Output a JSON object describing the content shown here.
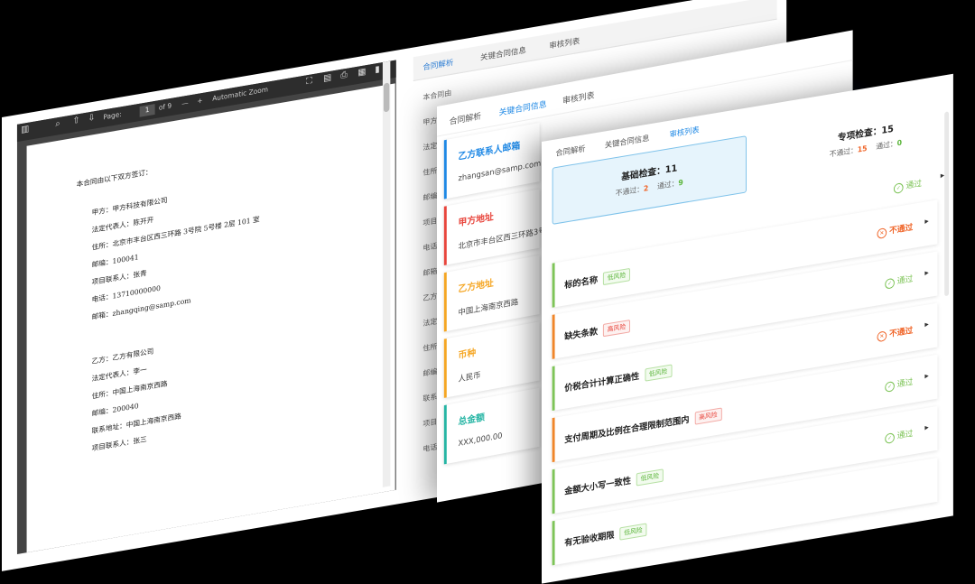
{
  "pdf_viewer": {
    "toolbar": {
      "page_label": "Page:",
      "page_number": "1",
      "page_total": "of 9",
      "zoom_minus": "—",
      "zoom_plus": "+",
      "zoom_select": "Automatic Zoom"
    },
    "doc_lines": [
      "本合同由以下双方签订：",
      "甲方：甲方科技有限公司",
      "法定代表人：陈开开",
      "住所：北京市丰台区西三环路 3号院 5号楼 2层 101 室",
      "邮编：100041",
      "项目联系人：张青",
      "电话：13710000000",
      "邮箱：zhangqing@samp.com",
      "乙方：乙方有限公司",
      "法定代表人：李一",
      "住所：中国上海南京西路",
      "邮编：200040",
      "联系地址：中国上海南京西路",
      "项目联系人：张三"
    ]
  },
  "panel1": {
    "tabs": [
      "合同解析",
      "关键合同信息",
      "审核列表"
    ],
    "rows": [
      "本合同由",
      "甲方：甲",
      "法定代表人",
      "住所：北",
      "邮编：100",
      "项目联系人",
      "电话：137",
      "邮箱：zh",
      "乙方：乙方",
      "法定代表人",
      "住所：中",
      "邮编：200",
      "联系地址：",
      "项目联系人",
      "电话："
    ]
  },
  "panel2": {
    "tabs": [
      "合同解析",
      "关键合同信息",
      "审核列表"
    ],
    "cards": [
      {
        "label": "乙方联系人邮箱",
        "value": "zhangsan@samp.com",
        "color": "#1e88e5"
      },
      {
        "label": "甲方地址",
        "value": "北京市丰台区西三环路3号",
        "color": "#e8453c"
      },
      {
        "label": "乙方地址",
        "value": "中国上海南京西路",
        "color": "#f5a623"
      },
      {
        "label": "币种",
        "value": "人民币",
        "color": "#f5a623"
      },
      {
        "label": "总金额",
        "value": "XXX,000.00",
        "color": "#26b5a4"
      }
    ]
  },
  "panel3": {
    "tabs": [
      "合同解析",
      "关键合同信息",
      "审核列表"
    ],
    "basic": {
      "title": "基础检查：",
      "count": "11",
      "fail_label": "不通过：",
      "fail": "2",
      "pass_label": "通过：",
      "pass": "9"
    },
    "special": {
      "title": "专项检查：",
      "count": "15",
      "fail_label": "不通过：",
      "fail": "15",
      "pass_label": "通过：",
      "pass": "0"
    },
    "top_status": "通过",
    "items": [
      {
        "name": "标的名称",
        "risk": "低风险",
        "risk_level": "low",
        "status": "不通过",
        "bar": "#7ec458"
      },
      {
        "name": "缺失条款",
        "risk": "高风险",
        "risk_level": "high",
        "status": "通过",
        "bar": "#f0862a"
      },
      {
        "name": "价税合计计算正确性",
        "risk": "低风险",
        "risk_level": "low",
        "status": "不通过",
        "bar": "#7ec458"
      },
      {
        "name": "支付周期及比例在合理限制范围内",
        "risk": "高风险",
        "risk_level": "high",
        "status": "通过",
        "bar": "#f0862a"
      },
      {
        "name": "金额大小写一致性",
        "risk": "低风险",
        "risk_level": "low",
        "status": "通过",
        "bar": "#7ec458"
      },
      {
        "name": "有无验收期限",
        "risk": "低风险",
        "risk_level": "low",
        "status": "",
        "bar": "#7ec458"
      }
    ]
  }
}
